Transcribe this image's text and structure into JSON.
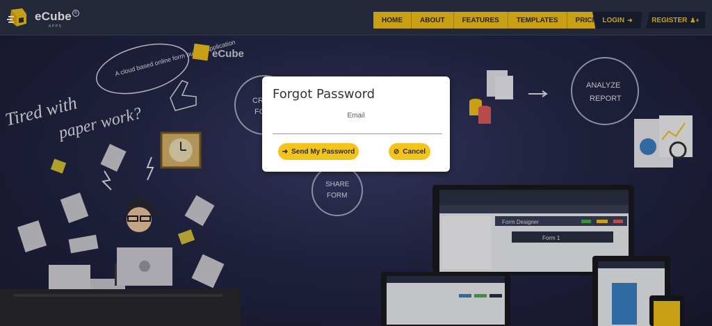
{
  "brand": {
    "name": "eCube",
    "sub": "APPS",
    "reg": "R"
  },
  "nav": {
    "items": [
      {
        "label": "HOME"
      },
      {
        "label": "ABOUT"
      },
      {
        "label": "FEATURES"
      },
      {
        "label": "TEMPLATES"
      },
      {
        "label": "PRICING"
      }
    ],
    "login": "LOGIN",
    "register": "REGISTER"
  },
  "hero": {
    "tired": "Tired with",
    "paper": "paper work?",
    "bubble": "A cloud based online form builder application",
    "share": "SHARE",
    "form": "FORM",
    "analyze": "ANALYZE",
    "report": "REPORT",
    "create": "CR",
    "create2": "FO",
    "form_designer": "Form Designer",
    "form1": "Form 1"
  },
  "modal": {
    "title": "Forgot Password",
    "email_label": "Email",
    "email_value": "",
    "send_label": "Send My Password",
    "cancel_label": "Cancel"
  },
  "colors": {
    "accent": "#f5c41a",
    "nav_bg": "#2b3146",
    "hero_bg": "#26284a"
  }
}
